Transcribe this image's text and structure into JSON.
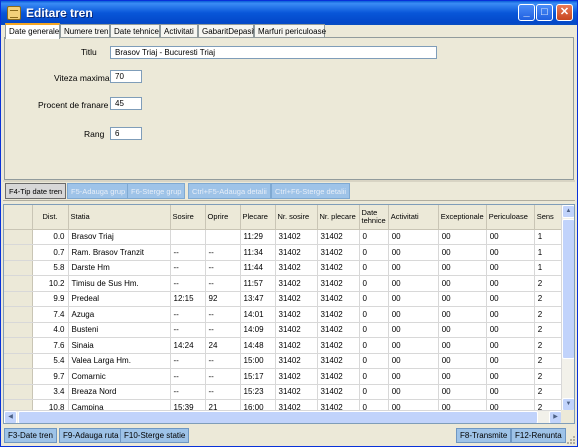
{
  "window": {
    "title": "Editare tren"
  },
  "tabs": [
    "Date generale",
    "Numere tren",
    "Date tehnice",
    "Activitati",
    "GabaritDepasit",
    "Marfuri periculoase"
  ],
  "form": {
    "titlu_label": "Titlu",
    "titlu_value": "Brasov Triaj - Bucuresti Triaj",
    "viteza_label": "Viteza maxima",
    "viteza_value": "70",
    "franare_label": "Procent de franare",
    "franare_value": "45",
    "rang_label": "Rang",
    "rang_value": "6"
  },
  "toolbar": {
    "btn1": "F4-Tip date tren",
    "btn2": "F5-Adauga grup",
    "btn3": "F6-Sterge grup",
    "btn4": "Ctrl+F5-Adauga detalii",
    "btn5": "Ctrl+F6-Sterge detalii"
  },
  "grid": {
    "columns": [
      "Dist.",
      "Statia",
      "Sosire",
      "Oprire",
      "Plecare",
      "Nr. sosire",
      "Nr. plecare",
      "Date tehnice",
      "Activitati",
      "Exceptionale",
      "Periculoase",
      "Sens"
    ],
    "rows": [
      [
        "0.0",
        "Brasov Triaj",
        "",
        "",
        "11:29",
        "31402",
        "31402",
        "0",
        "00",
        "00",
        "00",
        "1"
      ],
      [
        "0.7",
        "Ram. Brasov Tranzit",
        "--",
        "--",
        "11:34",
        "31402",
        "31402",
        "0",
        "00",
        "00",
        "00",
        "1"
      ],
      [
        "5.8",
        "Darste Hm",
        "--",
        "--",
        "11:44",
        "31402",
        "31402",
        "0",
        "00",
        "00",
        "00",
        "1"
      ],
      [
        "10.2",
        "Timisu de Sus Hm.",
        "--",
        "--",
        "11:57",
        "31402",
        "31402",
        "0",
        "00",
        "00",
        "00",
        "2"
      ],
      [
        "9.9",
        "Predeal",
        "12:15",
        "92",
        "13:47",
        "31402",
        "31402",
        "0",
        "00",
        "00",
        "00",
        "2"
      ],
      [
        "7.4",
        "Azuga",
        "--",
        "--",
        "14:01",
        "31402",
        "31402",
        "0",
        "00",
        "00",
        "00",
        "2"
      ],
      [
        "4.0",
        "Busteni",
        "--",
        "--",
        "14:09",
        "31402",
        "31402",
        "0",
        "00",
        "00",
        "00",
        "2"
      ],
      [
        "7.6",
        "Sinaia",
        "14:24",
        "24",
        "14:48",
        "31402",
        "31402",
        "0",
        "00",
        "00",
        "00",
        "2"
      ],
      [
        "5.4",
        "Valea Larga Hm.",
        "--",
        "--",
        "15:00",
        "31402",
        "31402",
        "0",
        "00",
        "00",
        "00",
        "2"
      ],
      [
        "9.7",
        "Comarnic",
        "--",
        "--",
        "15:17",
        "31402",
        "31402",
        "0",
        "00",
        "00",
        "00",
        "2"
      ],
      [
        "3.4",
        "Breaza Nord",
        "--",
        "--",
        "15:23",
        "31402",
        "31402",
        "0",
        "00",
        "00",
        "00",
        "2"
      ],
      [
        "10.8",
        "Campina",
        "15:39",
        "21",
        "16:00",
        "31402",
        "31402",
        "0",
        "00",
        "00",
        "00",
        "2"
      ]
    ]
  },
  "statusbar": {
    "f3": "F3-Date tren",
    "f9": "F9-Adauga ruta",
    "f10": "F10-Sterge statie",
    "f8": "F8-Transmite",
    "f12": "F12-Renunta"
  }
}
